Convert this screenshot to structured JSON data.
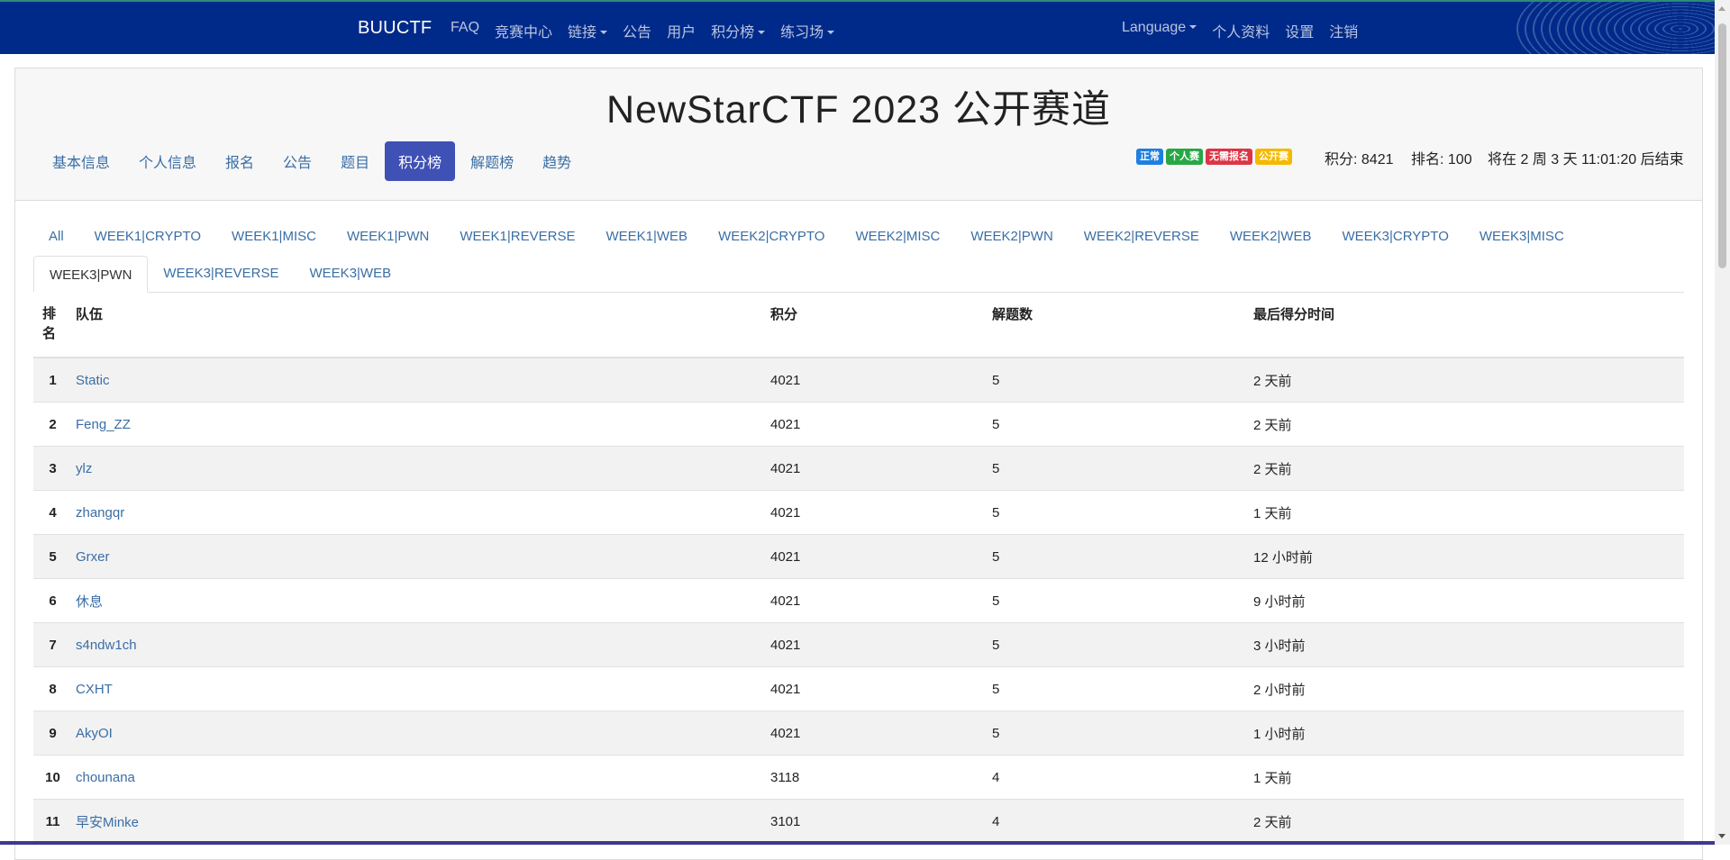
{
  "navbar": {
    "brand": "BUUCTF",
    "left_items": [
      {
        "label": "FAQ",
        "dropdown": false
      },
      {
        "label": "竞赛中心",
        "dropdown": false
      },
      {
        "label": "链接",
        "dropdown": true
      },
      {
        "label": "公告",
        "dropdown": false
      },
      {
        "label": "用户",
        "dropdown": false
      },
      {
        "label": "积分榜",
        "dropdown": true
      },
      {
        "label": "练习场",
        "dropdown": true
      }
    ],
    "right_items": [
      {
        "label": "Language",
        "dropdown": true
      },
      {
        "label": "个人资料",
        "dropdown": false
      },
      {
        "label": "设置",
        "dropdown": false
      },
      {
        "label": "注销",
        "dropdown": false
      }
    ],
    "bg_color": "#002a8a"
  },
  "page_title": "NewStarCTF 2023 公开赛道",
  "subnav": {
    "tabs": [
      "基本信息",
      "个人信息",
      "报名",
      "公告",
      "题目",
      "积分榜",
      "解题榜",
      "趋势"
    ],
    "active": "积分榜",
    "active_color": "#3f51b5"
  },
  "badges": [
    {
      "label": "正常",
      "color": "#1e7fe0"
    },
    {
      "label": "个人赛",
      "color": "#28a745"
    },
    {
      "label": "无需报名",
      "color": "#dc3545"
    },
    {
      "label": "公开赛",
      "color": "#f5b800"
    }
  ],
  "status": {
    "score": "积分: 8421",
    "rank": "排名: 100",
    "countdown": "将在 2 周 3 天 11:01:20 后结束"
  },
  "categories": {
    "row1": [
      "All",
      "WEEK1|CRYPTO",
      "WEEK1|MISC",
      "WEEK1|PWN",
      "WEEK1|REVERSE",
      "WEEK1|WEB",
      "WEEK2|CRYPTO",
      "WEEK2|MISC",
      "WEEK2|PWN",
      "WEEK2|REVERSE",
      "WEEK2|WEB",
      "WEEK3|CRYPTO",
      "WEEK3|MISC"
    ],
    "row2": [
      "WEEK3|PWN",
      "WEEK3|REVERSE",
      "WEEK3|WEB"
    ],
    "active": "WEEK3|PWN"
  },
  "table": {
    "headers": {
      "rank": "排名",
      "team": "队伍",
      "score": "积分",
      "solves": "解题数",
      "last": "最后得分时间"
    },
    "rows": [
      {
        "rank": "1",
        "team": "Static",
        "score": "4021",
        "solves": "5",
        "last": "2 天前"
      },
      {
        "rank": "2",
        "team": "Feng_ZZ",
        "score": "4021",
        "solves": "5",
        "last": "2 天前"
      },
      {
        "rank": "3",
        "team": "ylz",
        "score": "4021",
        "solves": "5",
        "last": "2 天前"
      },
      {
        "rank": "4",
        "team": "zhangqr",
        "score": "4021",
        "solves": "5",
        "last": "1 天前"
      },
      {
        "rank": "5",
        "team": "Grxer",
        "score": "4021",
        "solves": "5",
        "last": "12 小时前"
      },
      {
        "rank": "6",
        "team": "休息",
        "score": "4021",
        "solves": "5",
        "last": "9 小时前"
      },
      {
        "rank": "7",
        "team": "s4ndw1ch",
        "score": "4021",
        "solves": "5",
        "last": "3 小时前"
      },
      {
        "rank": "8",
        "team": "CXHT",
        "score": "4021",
        "solves": "5",
        "last": "2 小时前"
      },
      {
        "rank": "9",
        "team": "AkyOI",
        "score": "4021",
        "solves": "5",
        "last": "1 小时前"
      },
      {
        "rank": "10",
        "team": "chounana",
        "score": "3118",
        "solves": "4",
        "last": "1 天前"
      },
      {
        "rank": "11",
        "team": "早安Minke",
        "score": "3101",
        "solves": "4",
        "last": "2 天前"
      }
    ]
  }
}
